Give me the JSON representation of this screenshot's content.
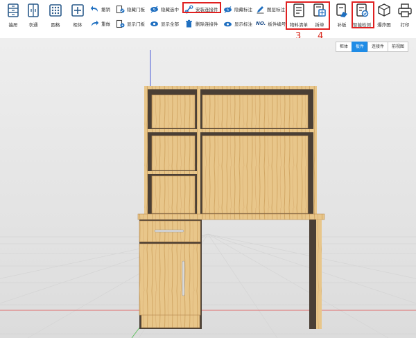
{
  "toolbar": {
    "big_left": [
      {
        "label": "抽屉",
        "icon": "drawer-icon"
      },
      {
        "label": "衣通",
        "icon": "wardrobe-rail-icon"
      },
      {
        "label": "圆格",
        "icon": "grid-icon"
      },
      {
        "label": "柜体",
        "icon": "cabinet-add-icon"
      }
    ],
    "small": [
      {
        "label": "撤销",
        "icon": "undo-icon"
      },
      {
        "label": "重做",
        "icon": "redo-icon"
      },
      {
        "label": "隐藏门板",
        "icon": "hide-door-icon"
      },
      {
        "label": "显示门板",
        "icon": "show-door-icon"
      },
      {
        "label": "隐藏选中",
        "icon": "hide-selected-icon"
      },
      {
        "label": "显示全部",
        "icon": "show-all-icon"
      },
      {
        "label": "安装连接件",
        "icon": "install-connector-icon"
      },
      {
        "label": "删除连接件",
        "icon": "delete-connector-icon"
      },
      {
        "label": "隐藏标注",
        "icon": "hide-annotation-icon"
      },
      {
        "label": "显示标注",
        "icon": "show-annotation-icon"
      },
      {
        "label": "图层标注",
        "icon": "layer-annotation-icon"
      },
      {
        "label": "板件编号",
        "icon": "panel-number-icon"
      }
    ],
    "panel_number_prefix": "NO.",
    "big_right": [
      {
        "label": "物料清单",
        "icon": "material-list-icon"
      },
      {
        "label": "拆单",
        "icon": "split-order-icon"
      },
      {
        "label": "补板",
        "icon": "patch-board-icon"
      },
      {
        "label": "智能检测",
        "icon": "smart-check-icon"
      },
      {
        "label": "爆炸图",
        "icon": "explode-view-icon"
      },
      {
        "label": "打印",
        "icon": "print-icon"
      }
    ]
  },
  "annotations": {
    "three": "3",
    "four": "4"
  },
  "view_tabs": [
    {
      "label": "柜体",
      "active": false
    },
    {
      "label": "板件",
      "active": true
    },
    {
      "label": "连接件",
      "active": false
    },
    {
      "label": "前视图",
      "active": false
    }
  ],
  "colors": {
    "accent": "#1f8ce6",
    "highlight_box": "#e02020",
    "annotation": "#d8281c",
    "wood_light": "#e9c88a",
    "wood_dark": "#c99a55",
    "carcass_inner": "#4a3f35"
  }
}
